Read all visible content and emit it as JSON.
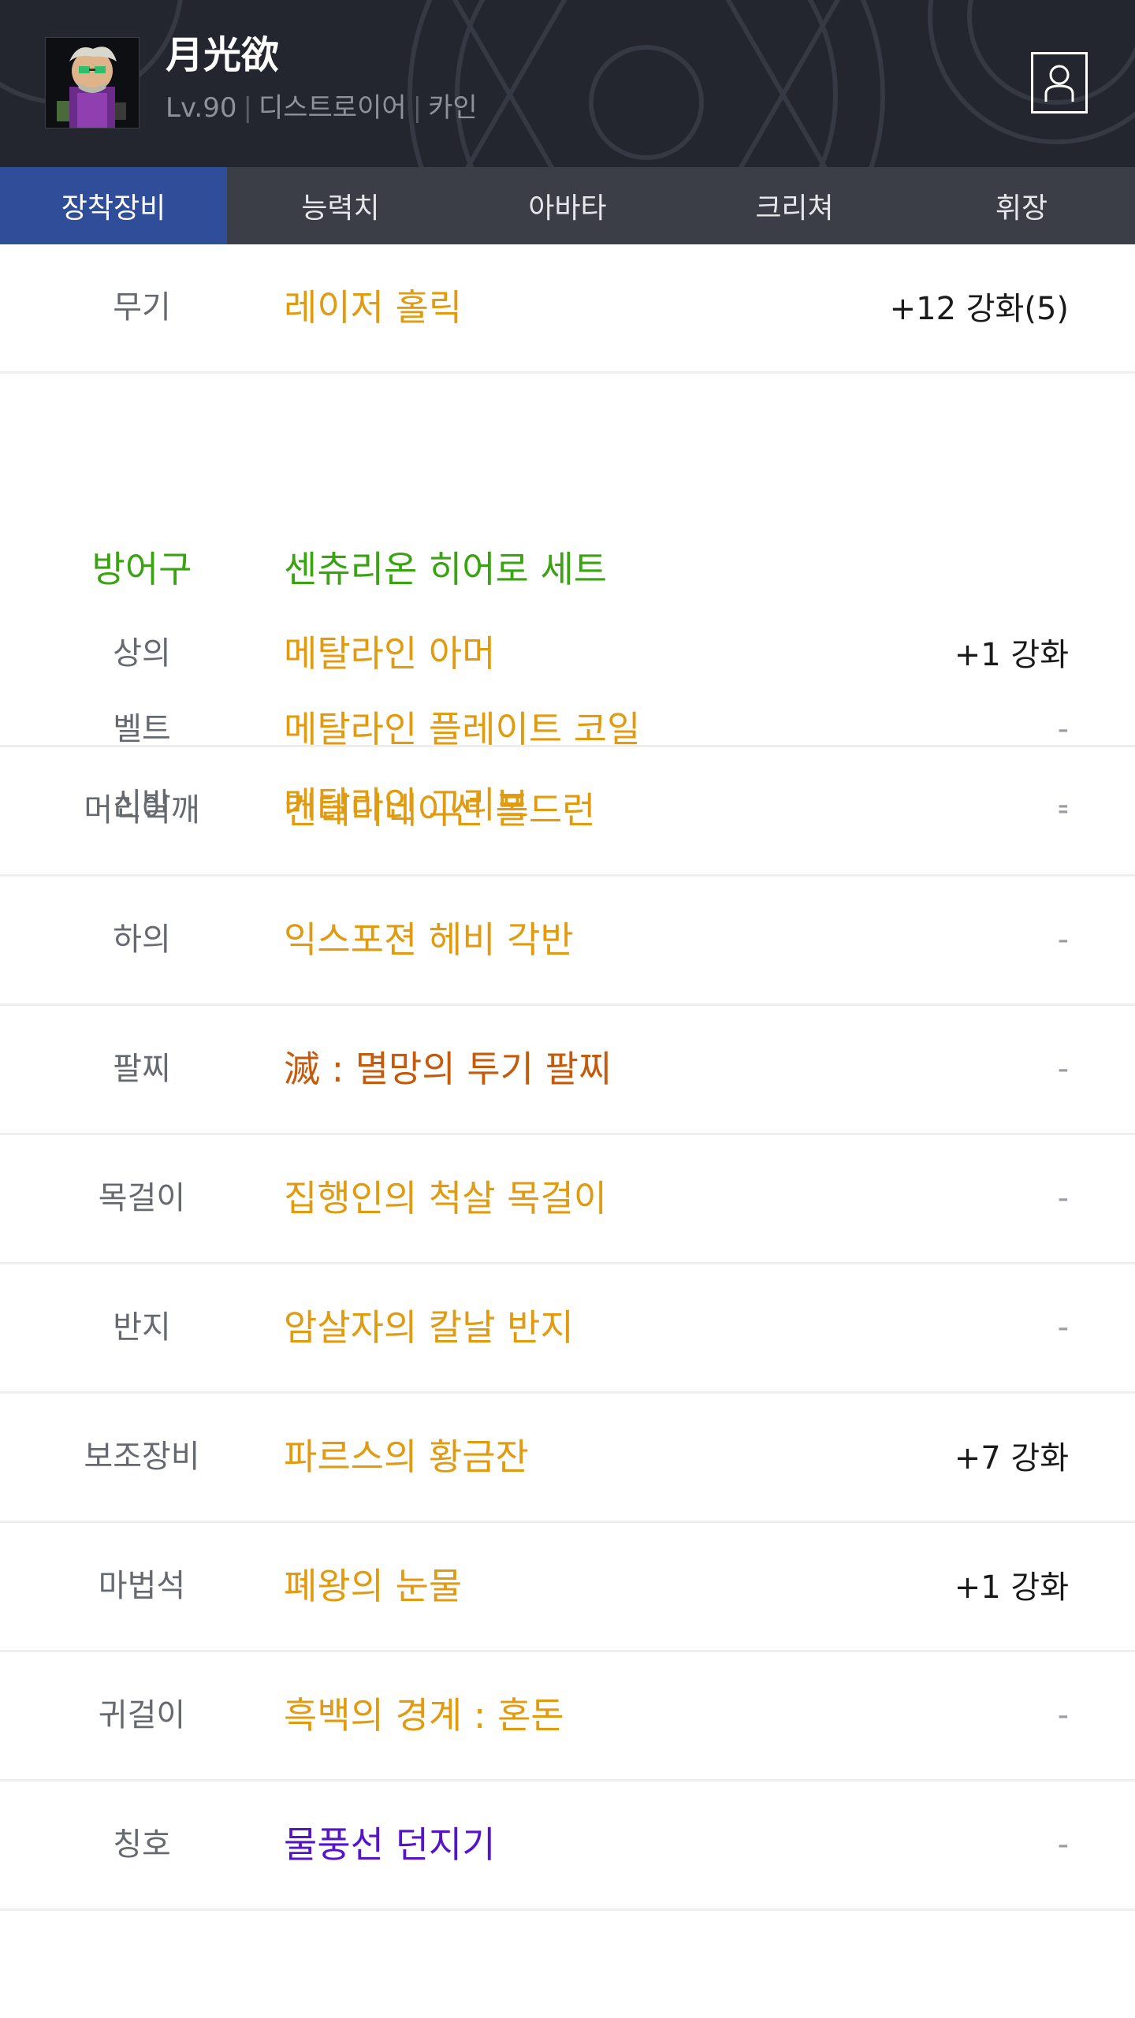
{
  "character": {
    "name": "月光欲",
    "level": "Lv.90",
    "job": "디스트로이어",
    "server": "카인",
    "separator": "|"
  },
  "tabs": [
    {
      "label": "장착장비",
      "active": true
    },
    {
      "label": "능력치",
      "active": false
    },
    {
      "label": "아바타",
      "active": false
    },
    {
      "label": "크리쳐",
      "active": false
    },
    {
      "label": "휘장",
      "active": false
    }
  ],
  "equipment": {
    "weapon": {
      "slot": "무기",
      "name": "레이저 홀릭",
      "enhance": "+12 강화(5)"
    },
    "armor_set": {
      "slot": "방어구",
      "set_name": "센츄리온 히어로 세트",
      "items": [
        {
          "slot": "상의",
          "name": "메탈라인 아머",
          "enhance": "+1 강화"
        },
        {
          "slot": "벨트",
          "name": "메탈라인 플레이트 코일",
          "enhance": "-"
        },
        {
          "slot": "신발",
          "name": "메탈라인 그리브",
          "enhance": "-"
        }
      ]
    },
    "others": [
      {
        "slot": "머리어깨",
        "name": "컨테미네이션 폴드런",
        "enhance": "-"
      },
      {
        "slot": "하의",
        "name": "익스포젼 헤비 각반",
        "enhance": "-"
      },
      {
        "slot": "팔찌",
        "name": "滅 : 멸망의 투기 팔찌",
        "enhance": "-"
      },
      {
        "slot": "목걸이",
        "name": "집행인의 척살 목걸이",
        "enhance": "-"
      },
      {
        "slot": "반지",
        "name": "암살자의 칼날 반지",
        "enhance": "-"
      },
      {
        "slot": "보조장비",
        "name": "파르스의 황금잔",
        "enhance": "+7 강화"
      },
      {
        "slot": "마법석",
        "name": "폐왕의 눈물",
        "enhance": "+1 강화"
      },
      {
        "slot": "귀걸이",
        "name": "흑백의 경계 : 혼돈",
        "enhance": "-"
      },
      {
        "slot": "칭호",
        "name": "물풍선 던지기",
        "enhance": "-"
      }
    ]
  },
  "colors": {
    "header_bg": "#23262e",
    "tab_bar": "#3b3e46",
    "tab_active": "#2f4d99",
    "unique_item": "#e09b10",
    "set_item": "#3aa312",
    "epic_item": "#c45a0b",
    "title_item": "#5514c8"
  },
  "icons": {
    "profile": "user-profile-icon",
    "avatar": "character-portrait"
  }
}
